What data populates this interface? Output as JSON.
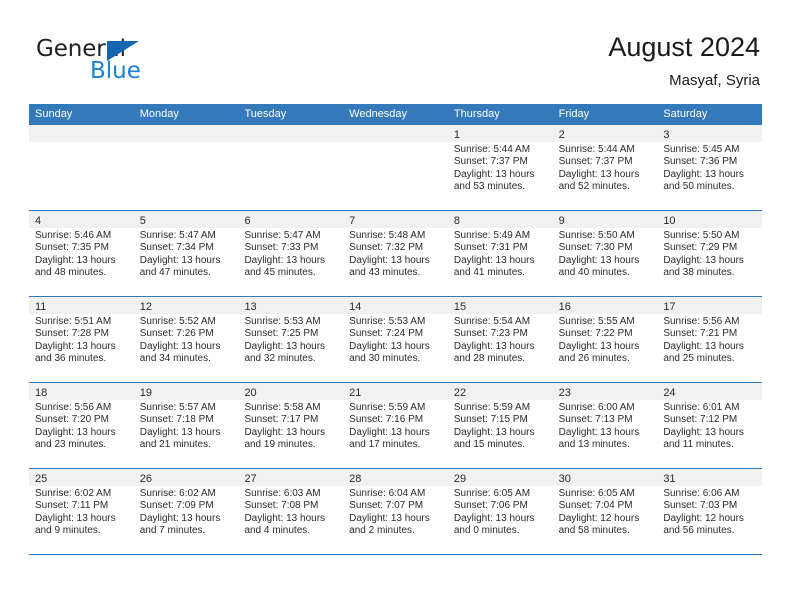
{
  "brand": {
    "name_top": "General",
    "name_bottom": "Blue",
    "triangle_color": "#1566b0",
    "blue_text_color": "#1b81d4"
  },
  "header": {
    "title": "August 2024",
    "subtitle": "Masyaf, Syria"
  },
  "theme": {
    "header_blue": "#3479b9",
    "day_band_gray": "#f1f1f1",
    "text_color": "#2b2b2b"
  },
  "weekdays": [
    "Sunday",
    "Monday",
    "Tuesday",
    "Wednesday",
    "Thursday",
    "Friday",
    "Saturday"
  ],
  "weeks": [
    [
      {
        "day": "",
        "sunrise": "",
        "sunset": "",
        "daylight_1": "",
        "daylight_2": ""
      },
      {
        "day": "",
        "sunrise": "",
        "sunset": "",
        "daylight_1": "",
        "daylight_2": ""
      },
      {
        "day": "",
        "sunrise": "",
        "sunset": "",
        "daylight_1": "",
        "daylight_2": ""
      },
      {
        "day": "",
        "sunrise": "",
        "sunset": "",
        "daylight_1": "",
        "daylight_2": ""
      },
      {
        "day": "1",
        "sunrise": "Sunrise: 5:44 AM",
        "sunset": "Sunset: 7:37 PM",
        "daylight_1": "Daylight: 13 hours",
        "daylight_2": "and 53 minutes."
      },
      {
        "day": "2",
        "sunrise": "Sunrise: 5:44 AM",
        "sunset": "Sunset: 7:37 PM",
        "daylight_1": "Daylight: 13 hours",
        "daylight_2": "and 52 minutes."
      },
      {
        "day": "3",
        "sunrise": "Sunrise: 5:45 AM",
        "sunset": "Sunset: 7:36 PM",
        "daylight_1": "Daylight: 13 hours",
        "daylight_2": "and 50 minutes."
      }
    ],
    [
      {
        "day": "4",
        "sunrise": "Sunrise: 5:46 AM",
        "sunset": "Sunset: 7:35 PM",
        "daylight_1": "Daylight: 13 hours",
        "daylight_2": "and 48 minutes."
      },
      {
        "day": "5",
        "sunrise": "Sunrise: 5:47 AM",
        "sunset": "Sunset: 7:34 PM",
        "daylight_1": "Daylight: 13 hours",
        "daylight_2": "and 47 minutes."
      },
      {
        "day": "6",
        "sunrise": "Sunrise: 5:47 AM",
        "sunset": "Sunset: 7:33 PM",
        "daylight_1": "Daylight: 13 hours",
        "daylight_2": "and 45 minutes."
      },
      {
        "day": "7",
        "sunrise": "Sunrise: 5:48 AM",
        "sunset": "Sunset: 7:32 PM",
        "daylight_1": "Daylight: 13 hours",
        "daylight_2": "and 43 minutes."
      },
      {
        "day": "8",
        "sunrise": "Sunrise: 5:49 AM",
        "sunset": "Sunset: 7:31 PM",
        "daylight_1": "Daylight: 13 hours",
        "daylight_2": "and 41 minutes."
      },
      {
        "day": "9",
        "sunrise": "Sunrise: 5:50 AM",
        "sunset": "Sunset: 7:30 PM",
        "daylight_1": "Daylight: 13 hours",
        "daylight_2": "and 40 minutes."
      },
      {
        "day": "10",
        "sunrise": "Sunrise: 5:50 AM",
        "sunset": "Sunset: 7:29 PM",
        "daylight_1": "Daylight: 13 hours",
        "daylight_2": "and 38 minutes."
      }
    ],
    [
      {
        "day": "11",
        "sunrise": "Sunrise: 5:51 AM",
        "sunset": "Sunset: 7:28 PM",
        "daylight_1": "Daylight: 13 hours",
        "daylight_2": "and 36 minutes."
      },
      {
        "day": "12",
        "sunrise": "Sunrise: 5:52 AM",
        "sunset": "Sunset: 7:26 PM",
        "daylight_1": "Daylight: 13 hours",
        "daylight_2": "and 34 minutes."
      },
      {
        "day": "13",
        "sunrise": "Sunrise: 5:53 AM",
        "sunset": "Sunset: 7:25 PM",
        "daylight_1": "Daylight: 13 hours",
        "daylight_2": "and 32 minutes."
      },
      {
        "day": "14",
        "sunrise": "Sunrise: 5:53 AM",
        "sunset": "Sunset: 7:24 PM",
        "daylight_1": "Daylight: 13 hours",
        "daylight_2": "and 30 minutes."
      },
      {
        "day": "15",
        "sunrise": "Sunrise: 5:54 AM",
        "sunset": "Sunset: 7:23 PM",
        "daylight_1": "Daylight: 13 hours",
        "daylight_2": "and 28 minutes."
      },
      {
        "day": "16",
        "sunrise": "Sunrise: 5:55 AM",
        "sunset": "Sunset: 7:22 PM",
        "daylight_1": "Daylight: 13 hours",
        "daylight_2": "and 26 minutes."
      },
      {
        "day": "17",
        "sunrise": "Sunrise: 5:56 AM",
        "sunset": "Sunset: 7:21 PM",
        "daylight_1": "Daylight: 13 hours",
        "daylight_2": "and 25 minutes."
      }
    ],
    [
      {
        "day": "18",
        "sunrise": "Sunrise: 5:56 AM",
        "sunset": "Sunset: 7:20 PM",
        "daylight_1": "Daylight: 13 hours",
        "daylight_2": "and 23 minutes."
      },
      {
        "day": "19",
        "sunrise": "Sunrise: 5:57 AM",
        "sunset": "Sunset: 7:18 PM",
        "daylight_1": "Daylight: 13 hours",
        "daylight_2": "and 21 minutes."
      },
      {
        "day": "20",
        "sunrise": "Sunrise: 5:58 AM",
        "sunset": "Sunset: 7:17 PM",
        "daylight_1": "Daylight: 13 hours",
        "daylight_2": "and 19 minutes."
      },
      {
        "day": "21",
        "sunrise": "Sunrise: 5:59 AM",
        "sunset": "Sunset: 7:16 PM",
        "daylight_1": "Daylight: 13 hours",
        "daylight_2": "and 17 minutes."
      },
      {
        "day": "22",
        "sunrise": "Sunrise: 5:59 AM",
        "sunset": "Sunset: 7:15 PM",
        "daylight_1": "Daylight: 13 hours",
        "daylight_2": "and 15 minutes."
      },
      {
        "day": "23",
        "sunrise": "Sunrise: 6:00 AM",
        "sunset": "Sunset: 7:13 PM",
        "daylight_1": "Daylight: 13 hours",
        "daylight_2": "and 13 minutes."
      },
      {
        "day": "24",
        "sunrise": "Sunrise: 6:01 AM",
        "sunset": "Sunset: 7:12 PM",
        "daylight_1": "Daylight: 13 hours",
        "daylight_2": "and 11 minutes."
      }
    ],
    [
      {
        "day": "25",
        "sunrise": "Sunrise: 6:02 AM",
        "sunset": "Sunset: 7:11 PM",
        "daylight_1": "Daylight: 13 hours",
        "daylight_2": "and 9 minutes."
      },
      {
        "day": "26",
        "sunrise": "Sunrise: 6:02 AM",
        "sunset": "Sunset: 7:09 PM",
        "daylight_1": "Daylight: 13 hours",
        "daylight_2": "and 7 minutes."
      },
      {
        "day": "27",
        "sunrise": "Sunrise: 6:03 AM",
        "sunset": "Sunset: 7:08 PM",
        "daylight_1": "Daylight: 13 hours",
        "daylight_2": "and 4 minutes."
      },
      {
        "day": "28",
        "sunrise": "Sunrise: 6:04 AM",
        "sunset": "Sunset: 7:07 PM",
        "daylight_1": "Daylight: 13 hours",
        "daylight_2": "and 2 minutes."
      },
      {
        "day": "29",
        "sunrise": "Sunrise: 6:05 AM",
        "sunset": "Sunset: 7:06 PM",
        "daylight_1": "Daylight: 13 hours",
        "daylight_2": "and 0 minutes."
      },
      {
        "day": "30",
        "sunrise": "Sunrise: 6:05 AM",
        "sunset": "Sunset: 7:04 PM",
        "daylight_1": "Daylight: 12 hours",
        "daylight_2": "and 58 minutes."
      },
      {
        "day": "31",
        "sunrise": "Sunrise: 6:06 AM",
        "sunset": "Sunset: 7:03 PM",
        "daylight_1": "Daylight: 12 hours",
        "daylight_2": "and 56 minutes."
      }
    ]
  ]
}
